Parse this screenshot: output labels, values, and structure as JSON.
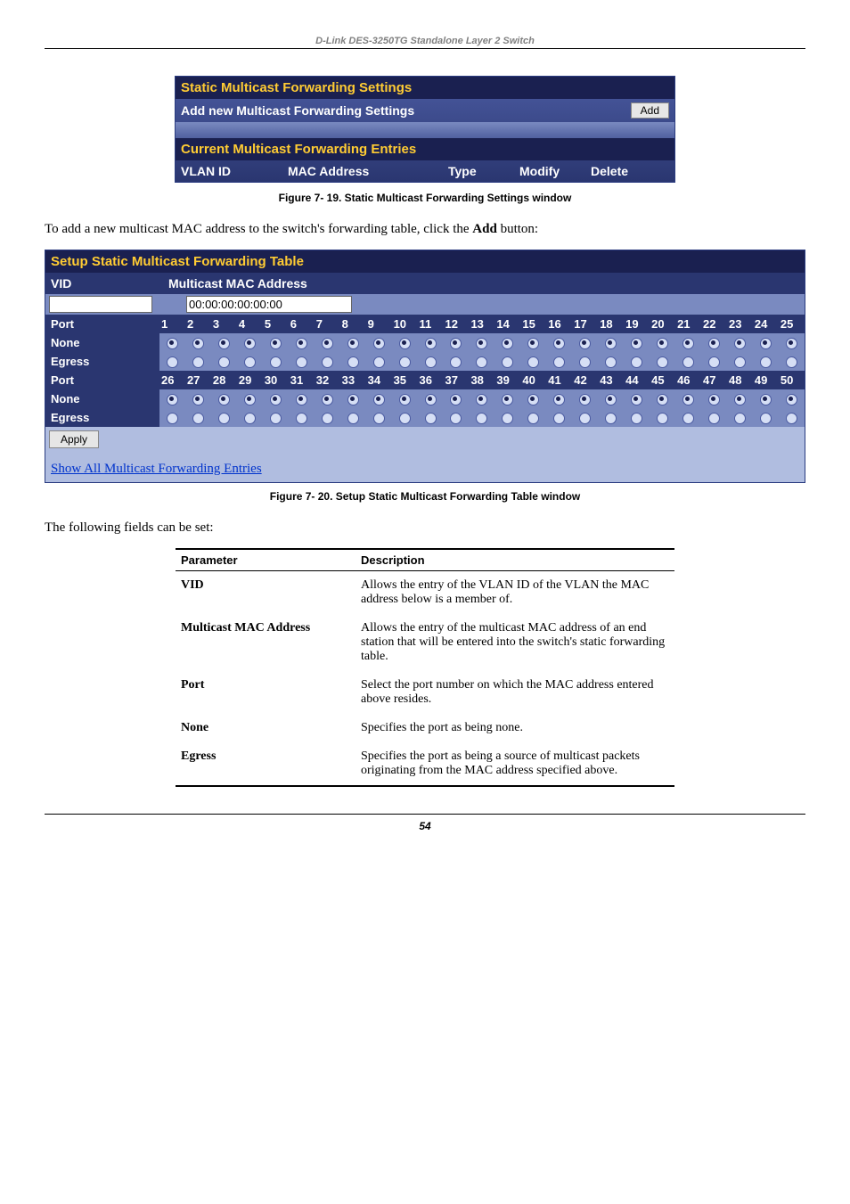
{
  "header": "D-Link DES-3250TG Standalone Layer 2 Switch",
  "panel1": {
    "title": "Static Multicast Forwarding Settings",
    "add_row_label": "Add new Multicast Forwarding Settings",
    "add_btn": "Add",
    "title2": "Current Multicast Forwarding Entries",
    "cols": {
      "vlan": "VLAN ID",
      "mac": "MAC Address",
      "type": "Type",
      "modify": "Modify",
      "delete": "Delete"
    }
  },
  "caption1": "Figure 7- 19.  Static Multicast Forwarding Settings window",
  "intro1": "To add a new multicast MAC address to the switch's forwarding table, click the ",
  "intro1_bold": "Add",
  "intro1_tail": " button:",
  "panel2": {
    "title": "Setup Static Multicast Forwarding Table",
    "vid_label": "VID",
    "mac_label": "Multicast MAC Address",
    "vid_value": "",
    "mac_value": "00:00:00:00:00:00",
    "port_label": "Port",
    "none_label": "None",
    "egress_label": "Egress",
    "ports1": [
      "1",
      "2",
      "3",
      "4",
      "5",
      "6",
      "7",
      "8",
      "9",
      "10",
      "11",
      "12",
      "13",
      "14",
      "15",
      "16",
      "17",
      "18",
      "19",
      "20",
      "21",
      "22",
      "23",
      "24",
      "25"
    ],
    "ports2": [
      "26",
      "27",
      "28",
      "29",
      "30",
      "31",
      "32",
      "33",
      "34",
      "35",
      "36",
      "37",
      "38",
      "39",
      "40",
      "41",
      "42",
      "43",
      "44",
      "45",
      "46",
      "47",
      "48",
      "49",
      "50"
    ],
    "apply_btn": "Apply",
    "link": "Show All Multicast Forwarding Entries"
  },
  "caption2": "Figure 7- 20.  Setup Static Multicast Forwarding Table window",
  "fields_intro": "The following fields can be set:",
  "param_headers": {
    "p": "Parameter",
    "d": "Description"
  },
  "params": [
    {
      "name": "VID",
      "desc": "Allows the entry of the VLAN ID of the VLAN the MAC address below is a member of."
    },
    {
      "name": "Multicast MAC Address",
      "desc": "Allows the entry of the multicast MAC address of an end station that will be entered into the switch's static forwarding table."
    },
    {
      "name": "Port",
      "desc": "Select the port number on which the MAC address entered above resides."
    },
    {
      "name": "None",
      "desc": "Specifies the port as being none."
    },
    {
      "name": "Egress",
      "desc": "Specifies the port as being a source of multicast packets originating from the MAC address specified above."
    }
  ],
  "page_number": "54"
}
